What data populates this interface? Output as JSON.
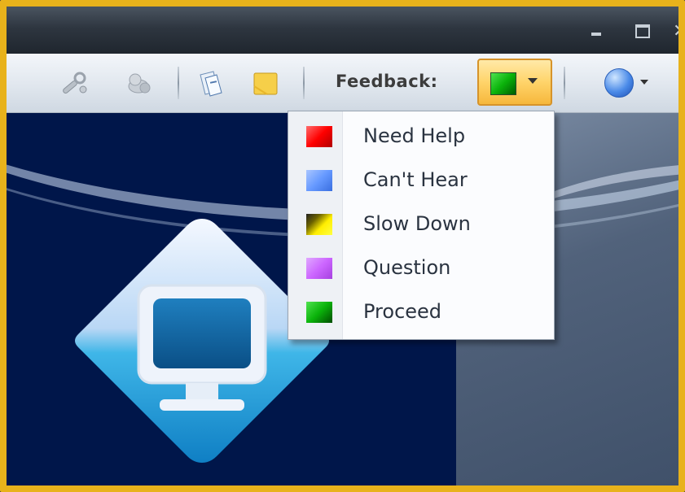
{
  "toolbar": {
    "feedback_label": "Feedback:",
    "selected_feedback_color": "#0bb30b"
  },
  "feedback_menu": {
    "items": [
      {
        "label": "Need Help",
        "color": "#ff0000"
      },
      {
        "label": "Can't Hear",
        "color": "#6699ff"
      },
      {
        "label": "Slow Down",
        "color": "#ffee00"
      },
      {
        "label": "Question",
        "color": "#cc66ff"
      },
      {
        "label": "Proceed",
        "color": "#0bb30b"
      }
    ]
  },
  "colors": {
    "frame_border": "#e8b21b",
    "highlight_button": "#ffd46a",
    "content_background": "#00164a"
  }
}
